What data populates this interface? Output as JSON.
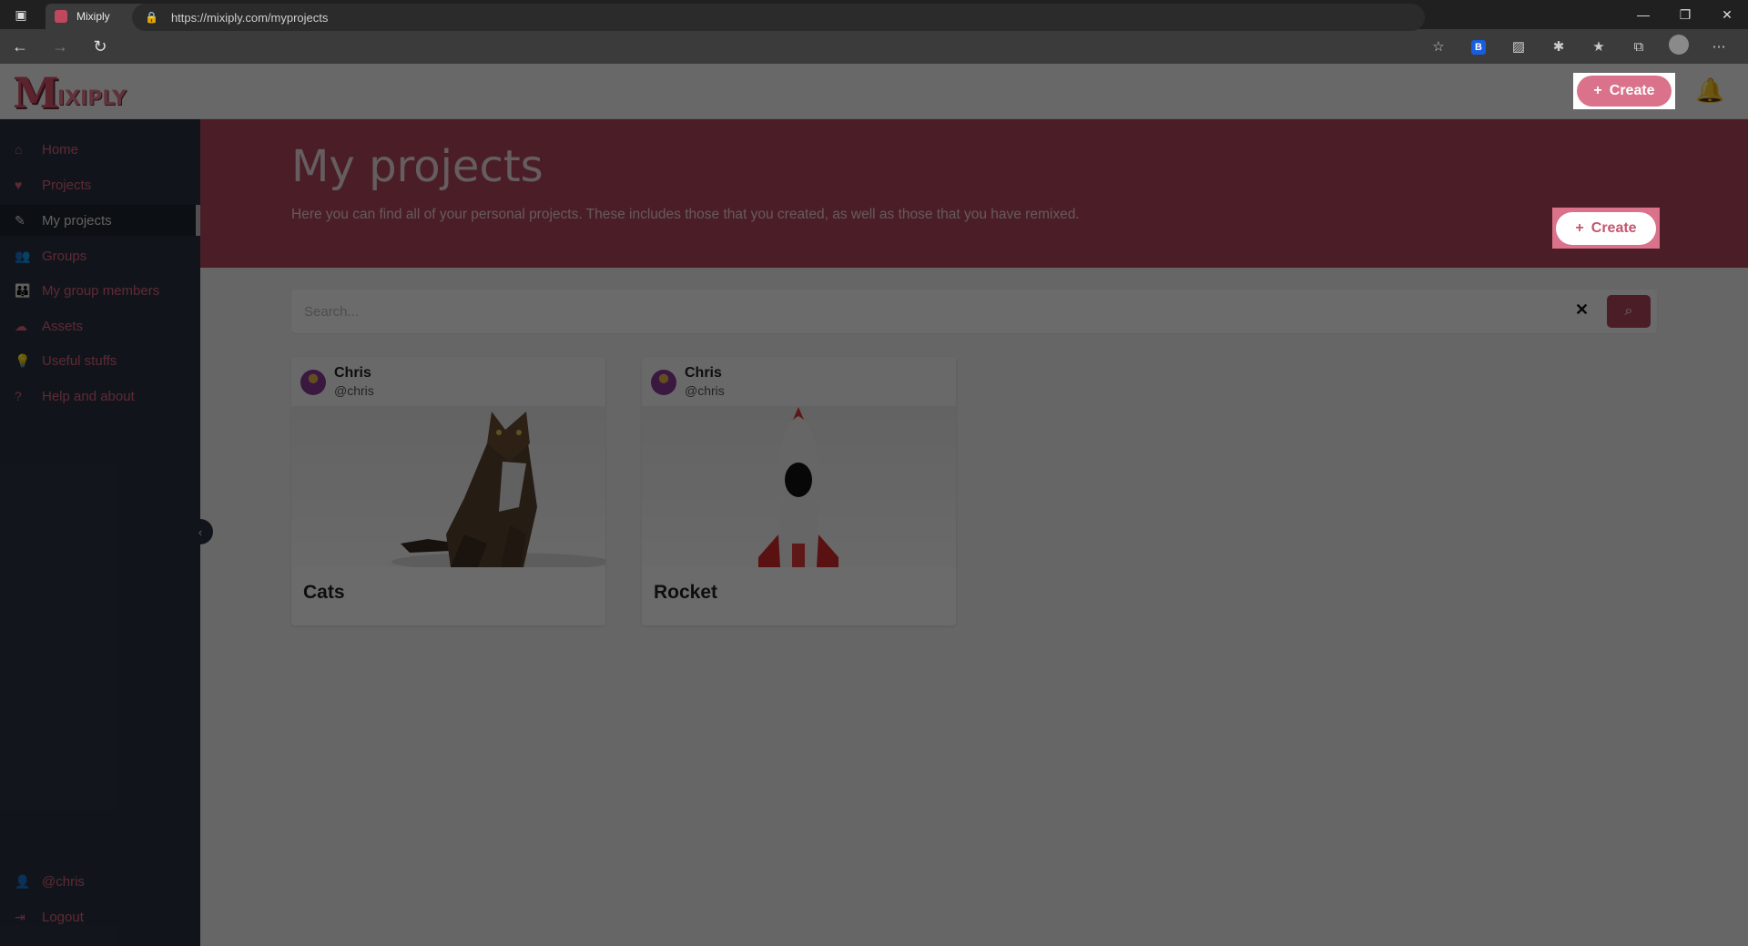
{
  "browser": {
    "tab_title": "Mixiply",
    "url": "https://mixiply.com/myprojects",
    "tab_close": "✕",
    "new_tab": "+"
  },
  "app": {
    "logo_big": "M",
    "logo_rest": "IXIPLY",
    "header_create_label": "Create",
    "bell_icon": "bell-icon"
  },
  "sidebar": {
    "items": [
      {
        "label": "Home",
        "icon": "home-icon"
      },
      {
        "label": "Projects",
        "icon": "heart-icon"
      },
      {
        "label": "My projects",
        "icon": "brush-icon"
      },
      {
        "label": "Groups",
        "icon": "users-icon"
      },
      {
        "label": "My group members",
        "icon": "group-icon"
      },
      {
        "label": "Assets",
        "icon": "cloud-icon"
      },
      {
        "label": "Useful stuffs",
        "icon": "bulb-icon"
      },
      {
        "label": "Help and about",
        "icon": "question-icon"
      }
    ],
    "user_label": "@chris",
    "logout_label": "Logout"
  },
  "banner": {
    "title": "My projects",
    "description": "Here you can find all of your personal projects. These includes those that you created, as well as those that you have remixed.",
    "create_label": "Create"
  },
  "search": {
    "placeholder": "Search...",
    "clear": "✕"
  },
  "projects": [
    {
      "author": "Chris",
      "handle": "@chris",
      "title": "Cats"
    },
    {
      "author": "Chris",
      "handle": "@chris",
      "title": "Rocket"
    }
  ],
  "colors": {
    "brand": "#b2485e",
    "brand_light": "#d9728a",
    "sidebar": "#2a3340"
  }
}
